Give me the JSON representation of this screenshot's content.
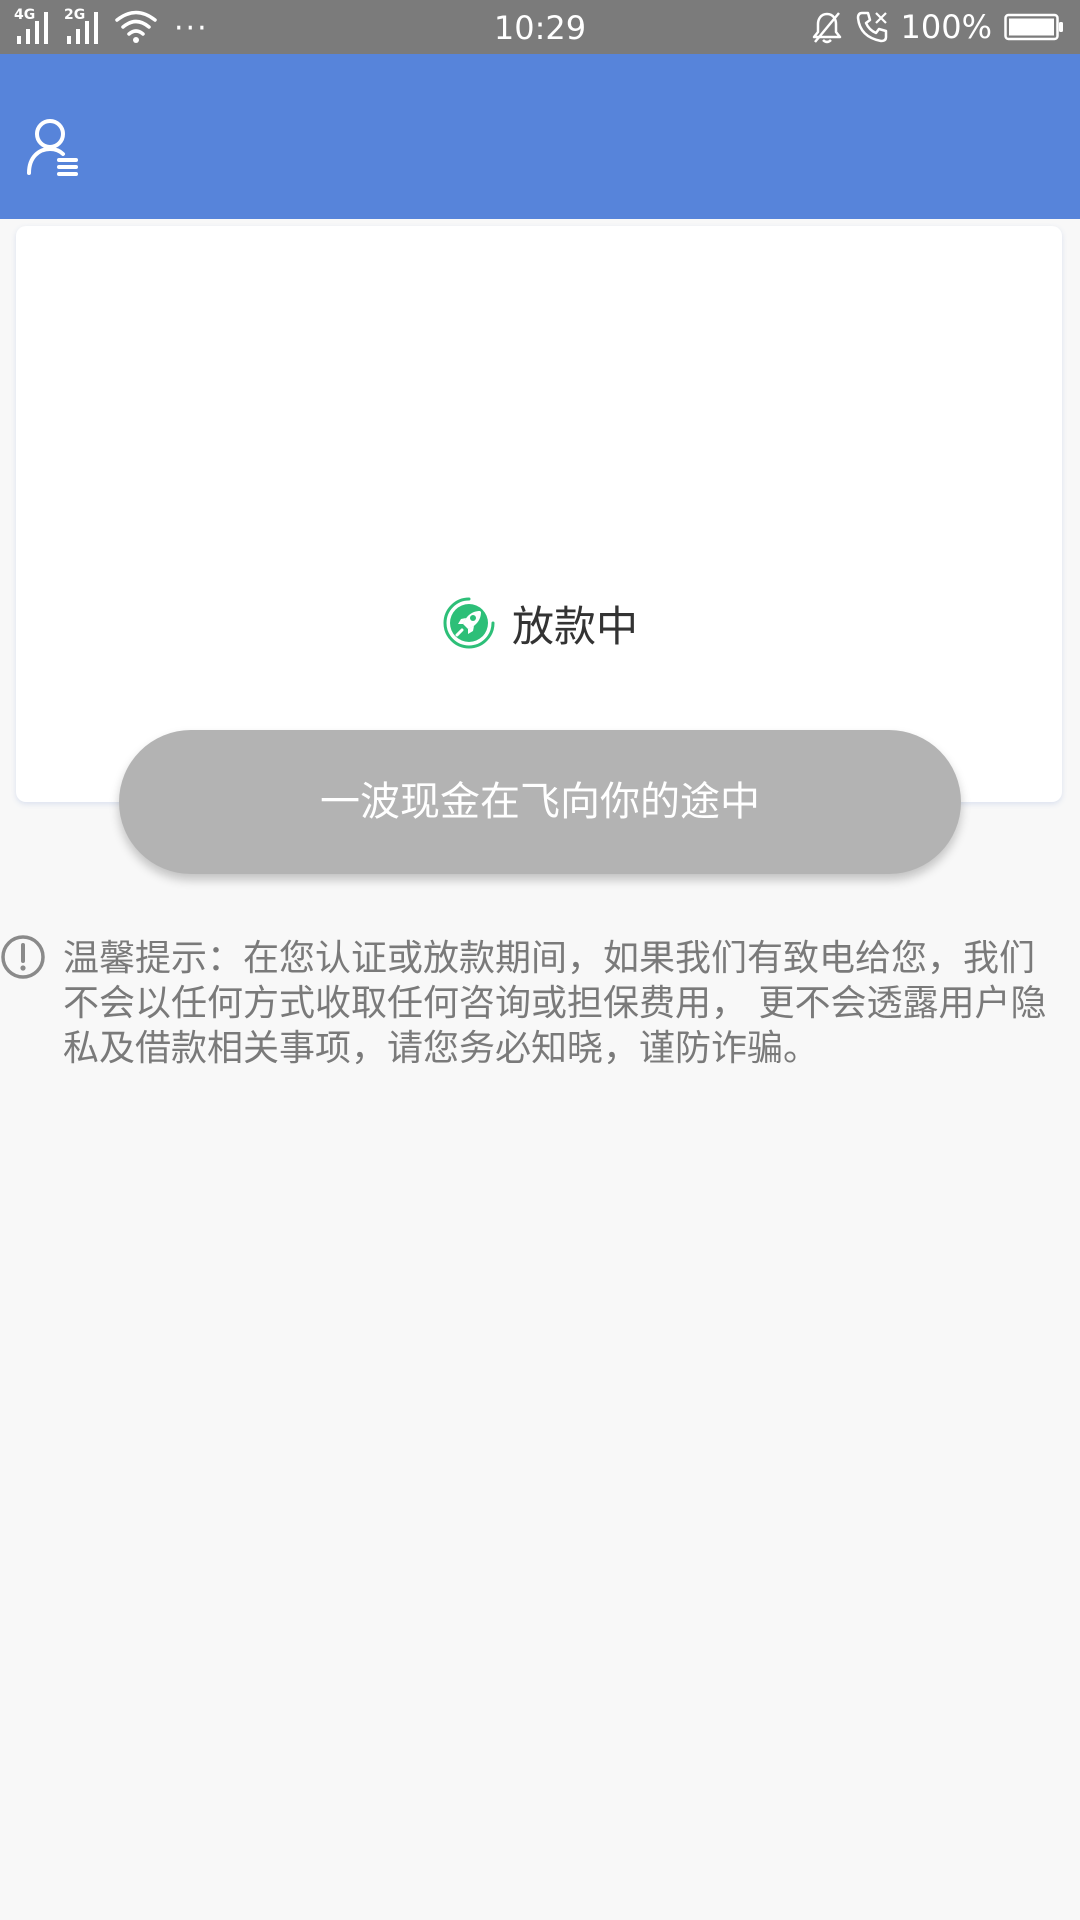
{
  "status_bar": {
    "network_1": "4G",
    "network_2": "2G",
    "more": "···",
    "time": "10:29",
    "battery": "100%",
    "icons": [
      "signal-icon",
      "signal-icon",
      "wifi-icon",
      "bell-muted-icon",
      "call-icon",
      "battery-icon"
    ]
  },
  "header": {
    "user_icon": "user-menu-icon",
    "color": "#5784da"
  },
  "loan_card": {
    "status_icon": "rocket-icon",
    "status_label": "放款中",
    "status_color": "#2dbf78"
  },
  "action_button": {
    "label": "一波现金在飞向你的途中",
    "color": "#b3b3b3"
  },
  "notice": {
    "icon": "exclamation-circle-icon",
    "text": "温馨提示：在您认证或放款期间，如果我们有致电给您，我们不会以任何方式收取任何咨询或担保费用， 更不会透露用户隐私及借款相关事项，请您务必知晓，谨防诈骗。"
  }
}
